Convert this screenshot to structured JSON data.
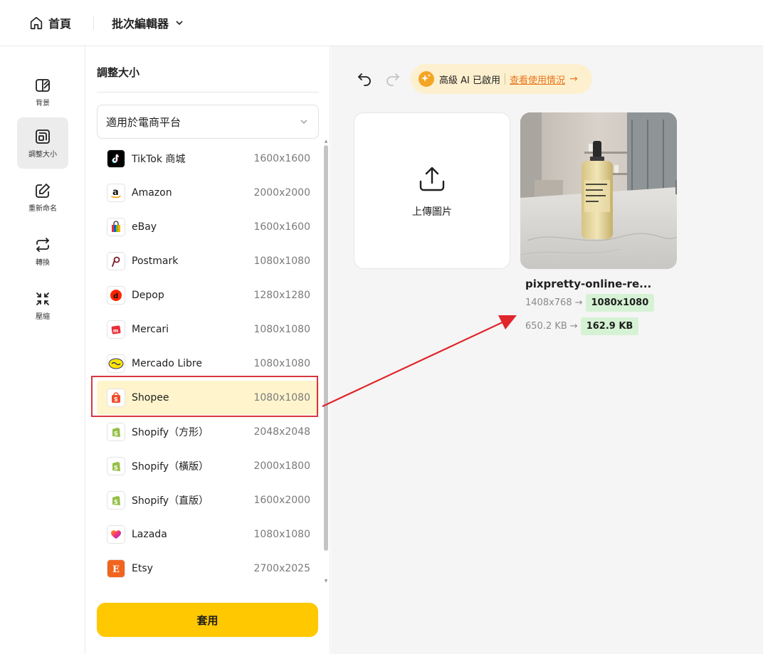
{
  "topbar": {
    "home_label": "首頁",
    "editor_label": "批次編輯器"
  },
  "nav": {
    "items": [
      {
        "label": "背景",
        "icon": "background-icon",
        "active": false
      },
      {
        "label": "調整大小",
        "icon": "resize-icon",
        "active": true
      },
      {
        "label": "重新命名",
        "icon": "rename-icon",
        "active": false
      },
      {
        "label": "轉換",
        "icon": "convert-icon",
        "active": false
      },
      {
        "label": "壓縮",
        "icon": "compress-icon",
        "active": false
      }
    ]
  },
  "panel": {
    "title": "調整大小",
    "select_value": "適用於電商平台",
    "apply_label": "套用",
    "platforms": [
      {
        "name": "TikTok 商城",
        "size": "1600x1600",
        "selected": false
      },
      {
        "name": "Amazon",
        "size": "2000x2000",
        "selected": false
      },
      {
        "name": "eBay",
        "size": "1600x1600",
        "selected": false
      },
      {
        "name": "Postmark",
        "size": "1080x1080",
        "selected": false
      },
      {
        "name": "Depop",
        "size": "1280x1280",
        "selected": false
      },
      {
        "name": "Mercari",
        "size": "1080x1080",
        "selected": false
      },
      {
        "name": "Mercado Libre",
        "size": "1080x1080",
        "selected": false
      },
      {
        "name": "Shopee",
        "size": "1080x1080",
        "selected": true
      },
      {
        "name": "Shopify（方形）",
        "size": "2048x2048",
        "selected": false
      },
      {
        "name": "Shopify（橫版）",
        "size": "2000x1800",
        "selected": false
      },
      {
        "name": "Shopify（直版）",
        "size": "1600x2000",
        "selected": false
      },
      {
        "name": "Lazada",
        "size": "1080x1080",
        "selected": false
      },
      {
        "name": "Etsy",
        "size": "2700x2025",
        "selected": false
      }
    ]
  },
  "workspace": {
    "ai_status": "高級 AI 已啟用",
    "ai_link": "查看使用情況",
    "ai_arrow": "→",
    "upload_label": "上傳圖片",
    "file": {
      "name": "pixpretty-online-re...",
      "orig_dims": "1408x768",
      "new_dims": "1080x1080",
      "orig_size": "650.2 KB",
      "new_size": "162.9 KB",
      "arrow": "→"
    }
  },
  "colors": {
    "accent": "#ffc800",
    "selected_row": "#fff4cc",
    "annotation": "#d9363e",
    "badge": "#d6f2d4"
  }
}
